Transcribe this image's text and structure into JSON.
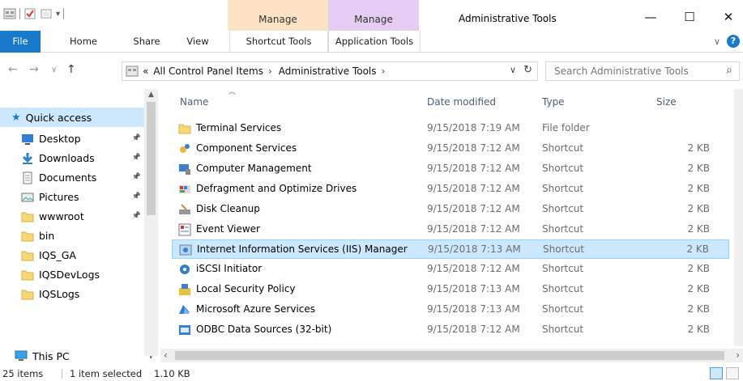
{
  "window": {
    "title": "Administrative Tools",
    "controls": {
      "minimize": "—",
      "maximize": "☐",
      "close": "✕"
    }
  },
  "context_tabs": {
    "manage_shortcut": "Manage",
    "manage_application": "Manage",
    "manage_shortcut_color": "#fbe3c4",
    "manage_application_color": "#e6cdf3"
  },
  "ribbon": {
    "tabs": [
      "File",
      "Home",
      "Share",
      "View",
      "Shortcut Tools",
      "Application Tools"
    ],
    "accent": "#1979ca"
  },
  "address": {
    "overflow": "«",
    "crumbs": [
      "All Control Panel Items",
      "Administrative Tools"
    ],
    "search_placeholder": "Search Administrative Tools"
  },
  "nav_pane": {
    "quick_access": "Quick access",
    "items": [
      {
        "label": "Desktop",
        "icon": "desktop-icon",
        "pinned": true
      },
      {
        "label": "Downloads",
        "icon": "downloads-icon",
        "pinned": true
      },
      {
        "label": "Documents",
        "icon": "documents-icon",
        "pinned": true
      },
      {
        "label": "Pictures",
        "icon": "pictures-icon",
        "pinned": true
      },
      {
        "label": "wwwroot",
        "icon": "folder-icon",
        "pinned": true
      },
      {
        "label": "bin",
        "icon": "folder-icon",
        "pinned": false
      },
      {
        "label": "IQS_GA",
        "icon": "folder-icon",
        "pinned": false
      },
      {
        "label": "IQSDevLogs",
        "icon": "folder-icon",
        "pinned": false
      },
      {
        "label": "IQSLogs",
        "icon": "folder-icon",
        "pinned": false
      }
    ],
    "this_pc": "This PC"
  },
  "columns": {
    "name": "Name",
    "date": "Date modified",
    "type": "Type",
    "size": "Size"
  },
  "files": [
    {
      "name": "Terminal Services",
      "date": "9/15/2018 7:19 AM",
      "type": "File folder",
      "size": "",
      "icon": "folder-icon"
    },
    {
      "name": "Component Services",
      "date": "9/15/2018 7:12 AM",
      "type": "Shortcut",
      "size": "2 KB",
      "icon": "component-services-icon"
    },
    {
      "name": "Computer Management",
      "date": "9/15/2018 7:12 AM",
      "type": "Shortcut",
      "size": "2 KB",
      "icon": "computer-management-icon"
    },
    {
      "name": "Defragment and Optimize Drives",
      "date": "9/15/2018 7:12 AM",
      "type": "Shortcut",
      "size": "2 KB",
      "icon": "defragment-icon"
    },
    {
      "name": "Disk Cleanup",
      "date": "9/15/2018 7:12 AM",
      "type": "Shortcut",
      "size": "2 KB",
      "icon": "disk-cleanup-icon"
    },
    {
      "name": "Event Viewer",
      "date": "9/15/2018 7:12 AM",
      "type": "Shortcut",
      "size": "2 KB",
      "icon": "event-viewer-icon"
    },
    {
      "name": "Internet Information Services (IIS) Manager",
      "date": "9/15/2018 7:13 AM",
      "type": "Shortcut",
      "size": "2 KB",
      "icon": "iis-manager-icon",
      "selected": true
    },
    {
      "name": "iSCSI Initiator",
      "date": "9/15/2018 7:12 AM",
      "type": "Shortcut",
      "size": "2 KB",
      "icon": "iscsi-icon"
    },
    {
      "name": "Local Security Policy",
      "date": "9/15/2018 7:13 AM",
      "type": "Shortcut",
      "size": "2 KB",
      "icon": "security-policy-icon"
    },
    {
      "name": "Microsoft Azure Services",
      "date": "9/15/2018 7:13 AM",
      "type": "Shortcut",
      "size": "2 KB",
      "icon": "azure-icon"
    },
    {
      "name": "ODBC Data Sources (32-bit)",
      "date": "9/15/2018 7:12 AM",
      "type": "Shortcut",
      "size": "2 KB",
      "icon": "odbc-icon"
    }
  ],
  "status": {
    "item_count": "25 items",
    "selection": "1 item selected",
    "selection_size": "1.10 KB"
  },
  "colors": {
    "selection": "#cce8ff",
    "selection_border": "#99d1ff"
  }
}
